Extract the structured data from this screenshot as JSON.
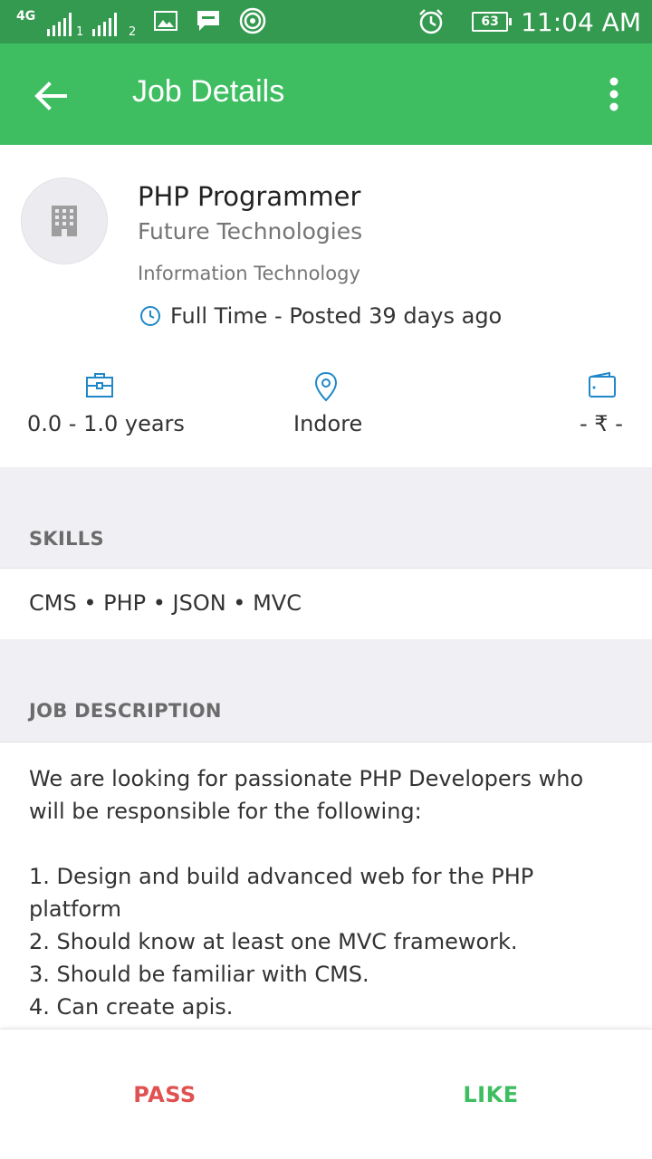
{
  "status_bar": {
    "network": "4G",
    "sim1": "1",
    "sim2": "2",
    "battery": "63",
    "time": "11:04 AM",
    "icons": [
      "signal-icon",
      "image-icon",
      "message-icon",
      "hotspot-icon",
      "alarm-icon",
      "battery-icon"
    ]
  },
  "app_bar": {
    "title": "Job Details",
    "back_icon": "arrow-back-icon",
    "menu_icon": "more-vert-icon",
    "color": "#3ebe61"
  },
  "job": {
    "title": "PHP Programmer",
    "company": "Future Technologies",
    "industry": "Information Technology",
    "posted": "Full Time - Posted 39 days ago"
  },
  "info": {
    "experience": "0.0 - 1.0 years",
    "location": "Indore",
    "salary": "- ₹ -"
  },
  "skills": {
    "heading": "SKILLS",
    "list": "CMS • PHP • JSON • MVC"
  },
  "description": {
    "heading": "JOB DESCRIPTION",
    "intro": "We are looking for passionate PHP Developers who will be responsible for the following:",
    "items": [
      "1.   Design and build advanced web for the PHP platform",
      "2.   Should know at least one MVC framework.",
      "3.   Should be familiar with CMS.",
      "4.   Can create apis."
    ]
  },
  "actions": {
    "pass": "PASS",
    "like": "LIKE",
    "pass_color": "#e05252",
    "like_color": "#3ebe61"
  }
}
